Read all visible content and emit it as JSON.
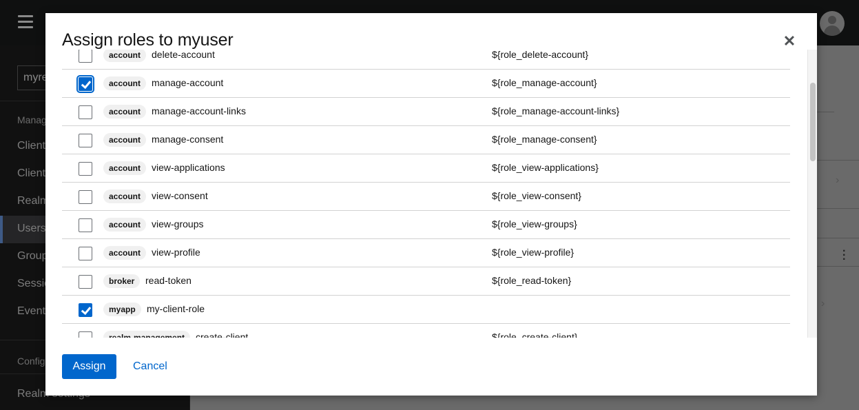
{
  "app": {
    "realm_selector": "myrealm",
    "sidebar": {
      "sections": [
        {
          "label": "Manage"
        },
        {
          "label": "Configure"
        }
      ],
      "items": [
        {
          "label": "Clients",
          "active": false
        },
        {
          "label": "Client scopes",
          "active": false
        },
        {
          "label": "Realm roles",
          "active": false
        },
        {
          "label": "Users",
          "active": true
        },
        {
          "label": "Groups",
          "active": false
        },
        {
          "label": "Sessions",
          "active": false
        },
        {
          "label": "Events",
          "active": false
        },
        {
          "label": "Realm settings",
          "active": false
        }
      ]
    },
    "user_avatar_icon": "user-avatar-icon",
    "menu_icon": "hamburger-icon"
  },
  "modal": {
    "title": "Assign roles to myuser",
    "close_icon": "close-icon",
    "roles": [
      {
        "client": "account",
        "name": "delete-account",
        "description": "${role_delete-account}",
        "checked": false
      },
      {
        "client": "account",
        "name": "manage-account",
        "description": "${role_manage-account}",
        "checked": true,
        "focused": true
      },
      {
        "client": "account",
        "name": "manage-account-links",
        "description": "${role_manage-account-links}",
        "checked": false
      },
      {
        "client": "account",
        "name": "manage-consent",
        "description": "${role_manage-consent}",
        "checked": false
      },
      {
        "client": "account",
        "name": "view-applications",
        "description": "${role_view-applications}",
        "checked": false
      },
      {
        "client": "account",
        "name": "view-consent",
        "description": "${role_view-consent}",
        "checked": false
      },
      {
        "client": "account",
        "name": "view-groups",
        "description": "${role_view-groups}",
        "checked": false
      },
      {
        "client": "account",
        "name": "view-profile",
        "description": "${role_view-profile}",
        "checked": false
      },
      {
        "client": "broker",
        "name": "read-token",
        "description": "${role_read-token}",
        "checked": false
      },
      {
        "client": "myapp",
        "name": "my-client-role",
        "description": "",
        "checked": true
      },
      {
        "client": "realm-management",
        "name": "create-client",
        "description": "${role_create-client}",
        "checked": false
      }
    ],
    "assign_label": "Assign",
    "cancel_label": "Cancel",
    "colors": {
      "primary": "#0066cc",
      "badge_bg": "#f0f0f0"
    }
  }
}
